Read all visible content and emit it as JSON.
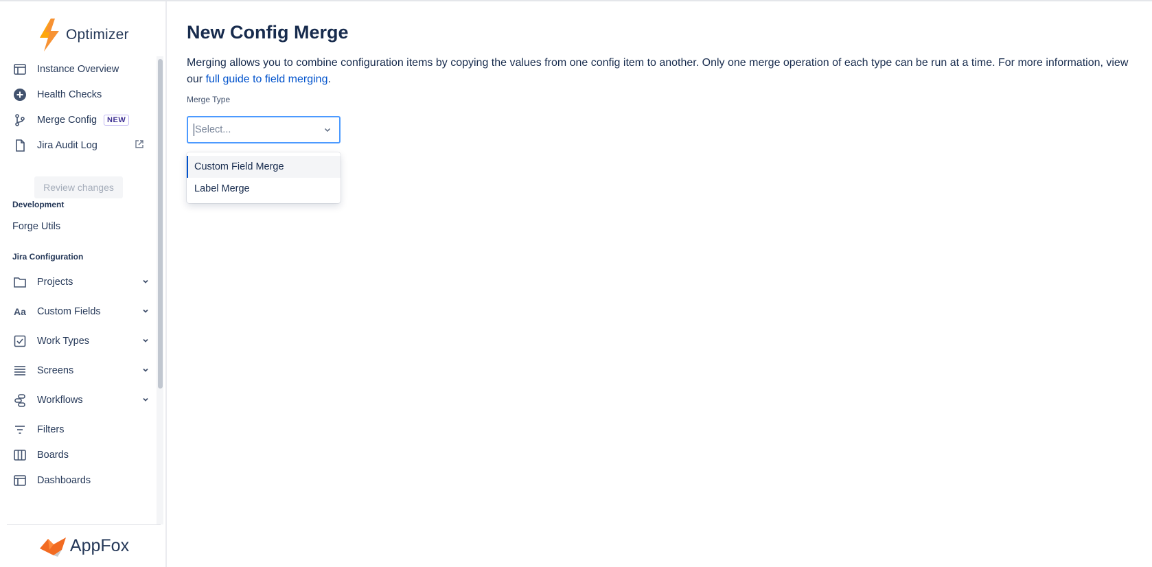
{
  "app": {
    "name": "Optimizer",
    "footer_brand": "AppFox"
  },
  "sidebar": {
    "top_items": [
      {
        "label": "Instance Overview",
        "icon": "layout-icon"
      },
      {
        "label": "Health Checks",
        "icon": "add-circle-icon"
      },
      {
        "label": "Merge Config",
        "icon": "branch-icon",
        "badge": "NEW"
      },
      {
        "label": "Jira Audit Log",
        "icon": "document-icon",
        "external": true
      }
    ],
    "review_button": "Review changes",
    "development_heading": "Development",
    "development_items": [
      "Forge Utils"
    ],
    "jira_config_heading": "Jira Configuration",
    "jira_config_items": [
      {
        "label": "Projects",
        "icon": "folder-icon",
        "expandable": true
      },
      {
        "label": "Custom Fields",
        "icon": "text-style-icon",
        "expandable": true
      },
      {
        "label": "Work Types",
        "icon": "checkbox-icon",
        "expandable": true
      },
      {
        "label": "Screens",
        "icon": "list-icon",
        "expandable": true
      },
      {
        "label": "Workflows",
        "icon": "workflow-icon",
        "expandable": true
      },
      {
        "label": "Filters",
        "icon": "filter-icon",
        "expandable": false
      },
      {
        "label": "Boards",
        "icon": "board-icon",
        "expandable": false
      },
      {
        "label": "Dashboards",
        "icon": "dashboard-icon",
        "expandable": false
      }
    ]
  },
  "main": {
    "title": "New Config Merge",
    "description_text": "Merging allows you to combine configuration items by copying the values from one config item to another. Only one merge operation of each type can be run at a time. For more information, view our ",
    "description_link": "full guide to field merging",
    "description_end": ".",
    "field_label": "Merge Type",
    "select_placeholder": "Select...",
    "options": [
      "Custom Field Merge",
      "Label Merge"
    ],
    "highlighted_option": "Custom Field Merge"
  },
  "colors": {
    "accent": "#0052cc",
    "focus_border": "#4c9aff",
    "logo_orange": "#f79233"
  }
}
